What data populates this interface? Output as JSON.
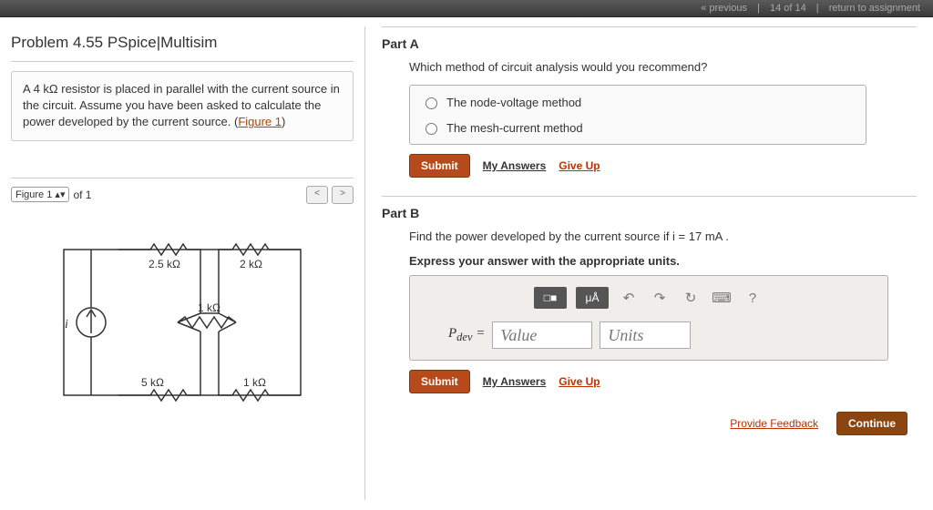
{
  "topbar": {
    "previous": "« previous",
    "counter": "14 of 14",
    "return": "return to assignment"
  },
  "problem": {
    "title": "Problem 4.55 PSpice|Multisim",
    "statement_prefix": "A 4 kΩ resistor is placed in parallel with the current source in the circuit. Assume you have been asked to calculate the power developed by the current source. (",
    "figure_link": "Figure 1",
    "statement_suffix": ")"
  },
  "figure": {
    "select_label": "Figure 1",
    "of_text": "of 1",
    "prev": "<",
    "next": ">",
    "labels": {
      "i": "i",
      "r1": "2.5 kΩ",
      "r2": "2 kΩ",
      "r3": "1 kΩ",
      "r4": "5 kΩ",
      "r5": "1 kΩ"
    }
  },
  "partA": {
    "title": "Part A",
    "question": "Which method of circuit analysis would you recommend?",
    "options": [
      "The node-voltage method",
      "The mesh-current method"
    ]
  },
  "partB": {
    "title": "Part B",
    "question": "Find the power developed by the current source if i = 17 mA .",
    "instruction": "Express your answer with the appropriate units.",
    "var_label": "Pdev =",
    "value_placeholder": "Value",
    "units_placeholder": "Units",
    "toolbar": {
      "format": "□■",
      "units": "μÅ",
      "undo": "↶",
      "redo": "↷",
      "reset": "↻",
      "keyb": "⌨",
      "help": "?"
    }
  },
  "actions": {
    "submit": "Submit",
    "my_answers": "My Answers",
    "give_up": "Give Up",
    "feedback": "Provide Feedback",
    "continue": "Continue"
  }
}
